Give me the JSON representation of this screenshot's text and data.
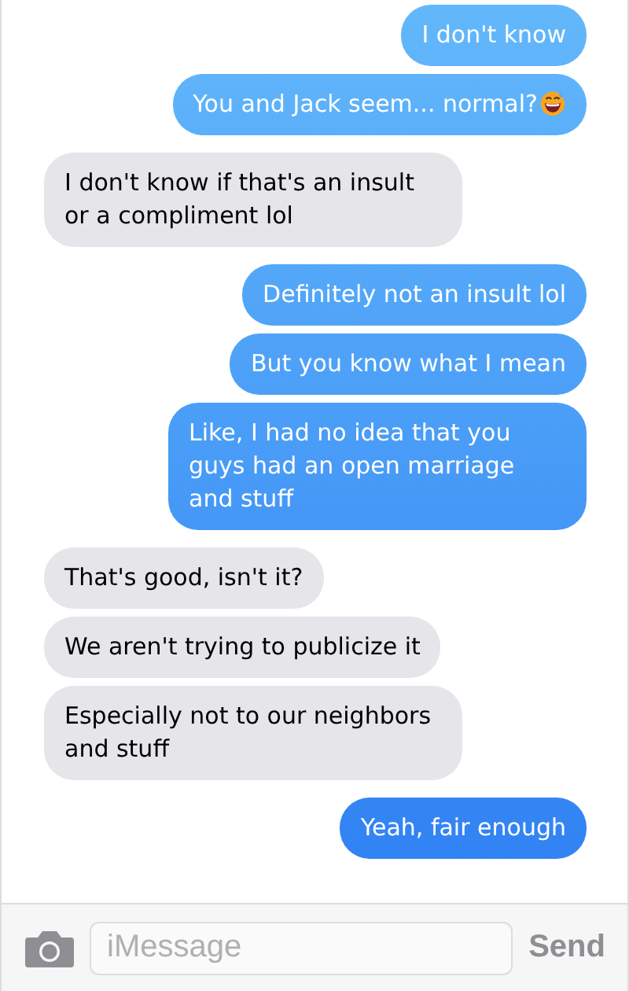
{
  "messages": [
    {
      "kind": "sent",
      "text": "I don't know"
    },
    {
      "kind": "sent",
      "text": "You and Jack seem... normal?",
      "emoji": true
    },
    {
      "kind": "received",
      "text": "I don't know if that's an insult or a compliment lol"
    },
    {
      "kind": "sent",
      "text": "Definitely not an insult lol"
    },
    {
      "kind": "sent",
      "text": "But you know what I mean"
    },
    {
      "kind": "sent",
      "text": "Like, I had no idea that you guys had an open marriage and stuff"
    },
    {
      "kind": "received",
      "text": "That's good, isn't it?"
    },
    {
      "kind": "received",
      "text": "We aren't trying to publicize it"
    },
    {
      "kind": "received",
      "text": "Especially not to our neighbors and stuff"
    },
    {
      "kind": "sent",
      "text": "Yeah, fair enough"
    }
  ],
  "composer": {
    "placeholder": "iMessage",
    "send": "Send"
  }
}
